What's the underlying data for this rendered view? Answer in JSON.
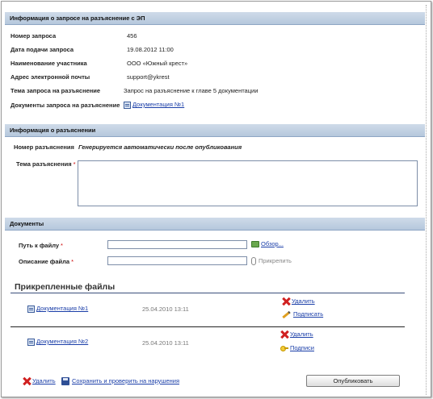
{
  "request_section": {
    "title": "Информация о запросе на разъяснение с ЭП",
    "fields": [
      {
        "label": "Номер запроса",
        "value": "456"
      },
      {
        "label": "Дата подачи запроса",
        "value": "19.08.2012 11:00"
      },
      {
        "label": "Наименование участника",
        "value": "ООО «Южный крест»"
      },
      {
        "label": "Адрес электронной почты",
        "value": "support@ykrest"
      },
      {
        "label": "Тема запроса на разъяснение",
        "value": "Запрос на разъяснение к главе 5 документации"
      },
      {
        "label": "Документы запроса на разъяснение",
        "value": "Документация №1"
      }
    ]
  },
  "clarification_section": {
    "title": "Информация о разъяснении",
    "number_label": "Номер разъяснения",
    "number_value": "Генерируется автоматически после опубликования",
    "topic_label": "Тема разъяснения",
    "required_mark": "*"
  },
  "documents_section": {
    "title": "Документы",
    "path_label": "Путь к файлу",
    "browse_label": "Обзор...",
    "description_label": "Описание файла",
    "attach_label": "Прикрепить",
    "required_mark": "*"
  },
  "attached_files": {
    "title": "Прикрепленные файлы",
    "items": [
      {
        "name": "Документация №1",
        "date": "25.04.2010 13:11",
        "delete_label": "Удалить",
        "sign_label": "Подписать"
      },
      {
        "name": "Документация №2",
        "date": "25.04.2010 13:11",
        "delete_label": "Удалить",
        "sign_label": "Подписи"
      }
    ]
  },
  "footer": {
    "delete_label": "Удалить",
    "save_label": "Сохранить и проверить на нарушения",
    "publish_label": "Опубликовать"
  },
  "colors": {
    "section_bar": "#c3d3e6",
    "link": "#1a3ea8",
    "required": "#cc0000"
  }
}
